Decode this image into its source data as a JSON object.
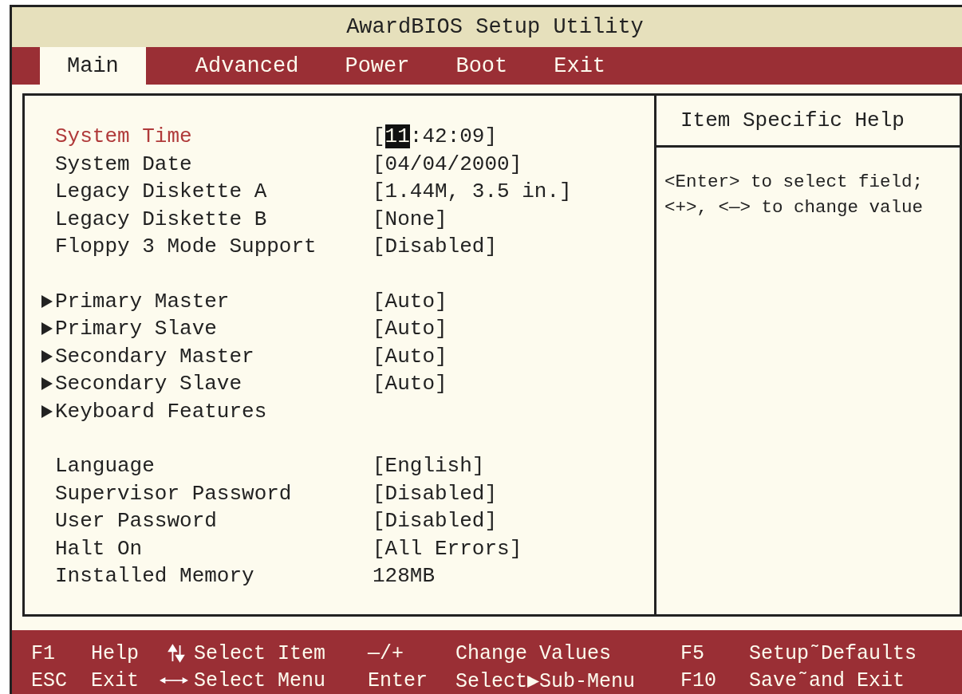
{
  "window": {
    "title": "AwardBIOS Setup Utility"
  },
  "tabs": [
    {
      "label": "Main",
      "selected": true
    },
    {
      "label": "Advanced",
      "selected": false
    },
    {
      "label": "Power",
      "selected": false
    },
    {
      "label": "Boot",
      "selected": false
    },
    {
      "label": "Exit",
      "selected": false
    }
  ],
  "settings": [
    [
      {
        "label": "System Time",
        "selected": true,
        "submenu": false,
        "value": [
          {
            "text": "[",
            "highlighted": false
          },
          {
            "text": "11",
            "highlighted": true
          },
          {
            "text": ":42:09]",
            "highlighted": false
          }
        ]
      },
      {
        "label": "System Date",
        "selected": false,
        "submenu": false,
        "value": [
          {
            "text": "[04/04/2000]",
            "highlighted": false
          }
        ]
      },
      {
        "label": "Legacy Diskette A",
        "selected": false,
        "submenu": false,
        "value": [
          {
            "text": "[1.44M, 3.5 in.]",
            "highlighted": false
          }
        ]
      },
      {
        "label": "Legacy Diskette B",
        "selected": false,
        "submenu": false,
        "value": [
          {
            "text": "[None]",
            "highlighted": false
          }
        ]
      },
      {
        "label": "Floppy 3 Mode Support",
        "selected": false,
        "submenu": false,
        "value": [
          {
            "text": "[Disabled]",
            "highlighted": false
          }
        ]
      }
    ],
    [
      {
        "label": "Primary Master",
        "selected": false,
        "submenu": true,
        "value": [
          {
            "text": "[Auto]",
            "highlighted": false
          }
        ]
      },
      {
        "label": "Primary Slave",
        "selected": false,
        "submenu": true,
        "value": [
          {
            "text": "[Auto]",
            "highlighted": false
          }
        ]
      },
      {
        "label": "Secondary Master",
        "selected": false,
        "submenu": true,
        "value": [
          {
            "text": "[Auto]",
            "highlighted": false
          }
        ]
      },
      {
        "label": "Secondary Slave",
        "selected": false,
        "submenu": true,
        "value": [
          {
            "text": "[Auto]",
            "highlighted": false
          }
        ]
      },
      {
        "label": "Keyboard Features",
        "selected": false,
        "submenu": true
      }
    ],
    [
      {
        "label": "Language",
        "selected": false,
        "submenu": false,
        "value": [
          {
            "text": "[English]",
            "highlighted": false
          }
        ]
      },
      {
        "label": "Supervisor Password",
        "selected": false,
        "submenu": false,
        "value": [
          {
            "text": "[Disabled]",
            "highlighted": false
          }
        ]
      },
      {
        "label": "User Password",
        "selected": false,
        "submenu": false,
        "value": [
          {
            "text": "[Disabled]",
            "highlighted": false
          }
        ]
      },
      {
        "label": "Halt On",
        "selected": false,
        "submenu": false,
        "value": [
          {
            "text": "[All Errors]",
            "highlighted": false
          }
        ]
      },
      {
        "label": "Installed Memory",
        "selected": false,
        "submenu": false,
        "value": [
          {
            "text": "128MB",
            "highlighted": false
          }
        ]
      }
    ]
  ],
  "help": {
    "title": "Item Specific Help",
    "lines": [
      "<Enter> to select field;",
      "<+>, <—> to change value"
    ]
  },
  "footer": [
    [
      {
        "kind": "text",
        "text": "F1"
      },
      {
        "kind": "text",
        "text": "Help"
      },
      {
        "kind": "updown"
      },
      {
        "kind": "text",
        "text": "Select Item"
      },
      {
        "kind": "text",
        "text": "—/+"
      },
      {
        "kind": "text",
        "text": "Change Values"
      },
      {
        "kind": "text",
        "text": "F5"
      },
      {
        "kind": "text",
        "text": "Setup˜Defaults"
      }
    ],
    [
      {
        "kind": "text",
        "text": "ESC"
      },
      {
        "kind": "text",
        "text": "Exit"
      },
      {
        "kind": "leftright"
      },
      {
        "kind": "text",
        "text": "Select Menu"
      },
      {
        "kind": "text",
        "text": "Enter"
      },
      {
        "kind": "text",
        "text": "Select▶Sub-Menu"
      },
      {
        "kind": "text",
        "text": "F10"
      },
      {
        "kind": "text",
        "text": "Save˜and Exit"
      }
    ]
  ]
}
